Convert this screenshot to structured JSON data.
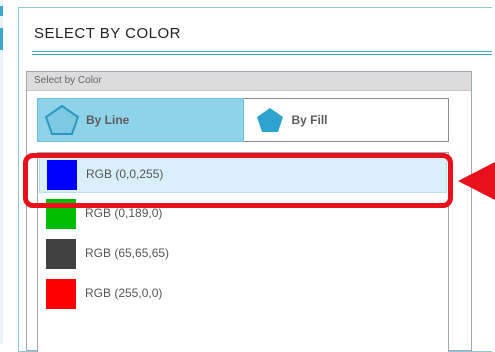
{
  "panel": {
    "title": "SELECT BY COLOR"
  },
  "inner_panel": {
    "header": "Select by Color"
  },
  "tabs": [
    {
      "label": "By Line",
      "icon": "pentagon-outline-icon",
      "active": true
    },
    {
      "label": "By Fill",
      "icon": "pentagon-filled-icon",
      "active": false
    }
  ],
  "colors": [
    {
      "label": "RGB (0,0,255)",
      "swatch": "#0000ff",
      "selected": true
    },
    {
      "label": "RGB (0,189,0)",
      "swatch": "#00bd00",
      "selected": false
    },
    {
      "label": "RGB (65,65,65)",
      "swatch": "#414141",
      "selected": false
    },
    {
      "label": "RGB (255,0,0)",
      "swatch": "#ff0000",
      "selected": false
    }
  ],
  "theme": {
    "accent": "#39a9cf",
    "active_tab": "#8ed3ea",
    "selected_row": "#d9eff9",
    "highlight": "#e8101a"
  }
}
